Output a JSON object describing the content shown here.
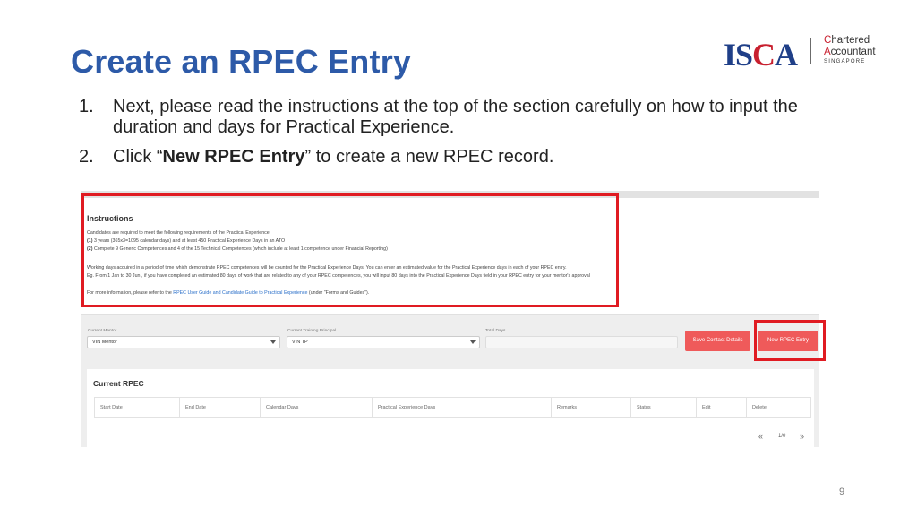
{
  "slide": {
    "title": "Create an RPEC Entry",
    "page_number": "9"
  },
  "logo": {
    "isca_prefix": "IS",
    "isca_c": "C",
    "isca_suffix": "A",
    "ca_line1_cap": "C",
    "ca_line1_rest": "hartered",
    "ca_line2_cap": "A",
    "ca_line2_rest": "ccountant",
    "ca_line3": "SINGAPORE"
  },
  "steps": [
    {
      "num": "1.",
      "text": "Next, please read the instructions at the top of the section carefully on how to input the duration and days for Practical Experience."
    },
    {
      "num": "2.",
      "prefix": "Click “",
      "bold": "New RPEC Entry",
      "suffix": "” to create a new RPEC record."
    }
  ],
  "instructions": {
    "title": "Instructions",
    "line1": "Candidates are required to meet the following requirements of the Practical Experience:",
    "line2_num": "(1)",
    "line2": " 3 years (365x3=1095 calendar days) and at least 450 Practical Experience Days in an ATO",
    "line3_num": "(2)",
    "line3": " Complete 9 Generic Competences and 4 of the 15 Technical Competences (which include at least 1 competence under Financial Reporting)",
    "line4": "Working days acquired in a period of time which demonstrate RPEC competences will be counted for the Practical Experience Days. You can enter an estimated value for the Practical Experience days in each of your RPEC entry.",
    "line5": "Eg. From 1 Jan to 30 Jun , if you have completed an estimated 80 days of work that are related to any of your RPEC competences, you will input 80 days into the Practical Experience Days field in your RPEC entry for your mentor's approval",
    "line6_prefix": "For more information, please refer to the ",
    "line6_link": "RPEC User Guide and Candidate Guide to Practical Experience",
    "line6_suffix": " (under \"Forms and Guides\")."
  },
  "form": {
    "mentor_label": "Current Mentor",
    "mentor_value": "VIN Mentor",
    "principal_label": "Current Training Principal",
    "principal_value": "VIN TP",
    "total_days_label": "Total Days",
    "save_button": "Save Contact Details",
    "new_button": "New RPEC Entry"
  },
  "rpec": {
    "title": "Current RPEC",
    "columns": [
      "Start Date",
      "End Date",
      "Calendar Days",
      "Practical Experience Days",
      "Remarks",
      "Status",
      "Edit",
      "Delete"
    ],
    "pager_prev": "«",
    "pager_text": "1/0",
    "pager_next": "»"
  },
  "colors": {
    "title_blue": "#2d5aa8",
    "highlight_red": "#e01b22",
    "button_red": "#ef5a5a",
    "link_blue": "#2a6fc9"
  }
}
